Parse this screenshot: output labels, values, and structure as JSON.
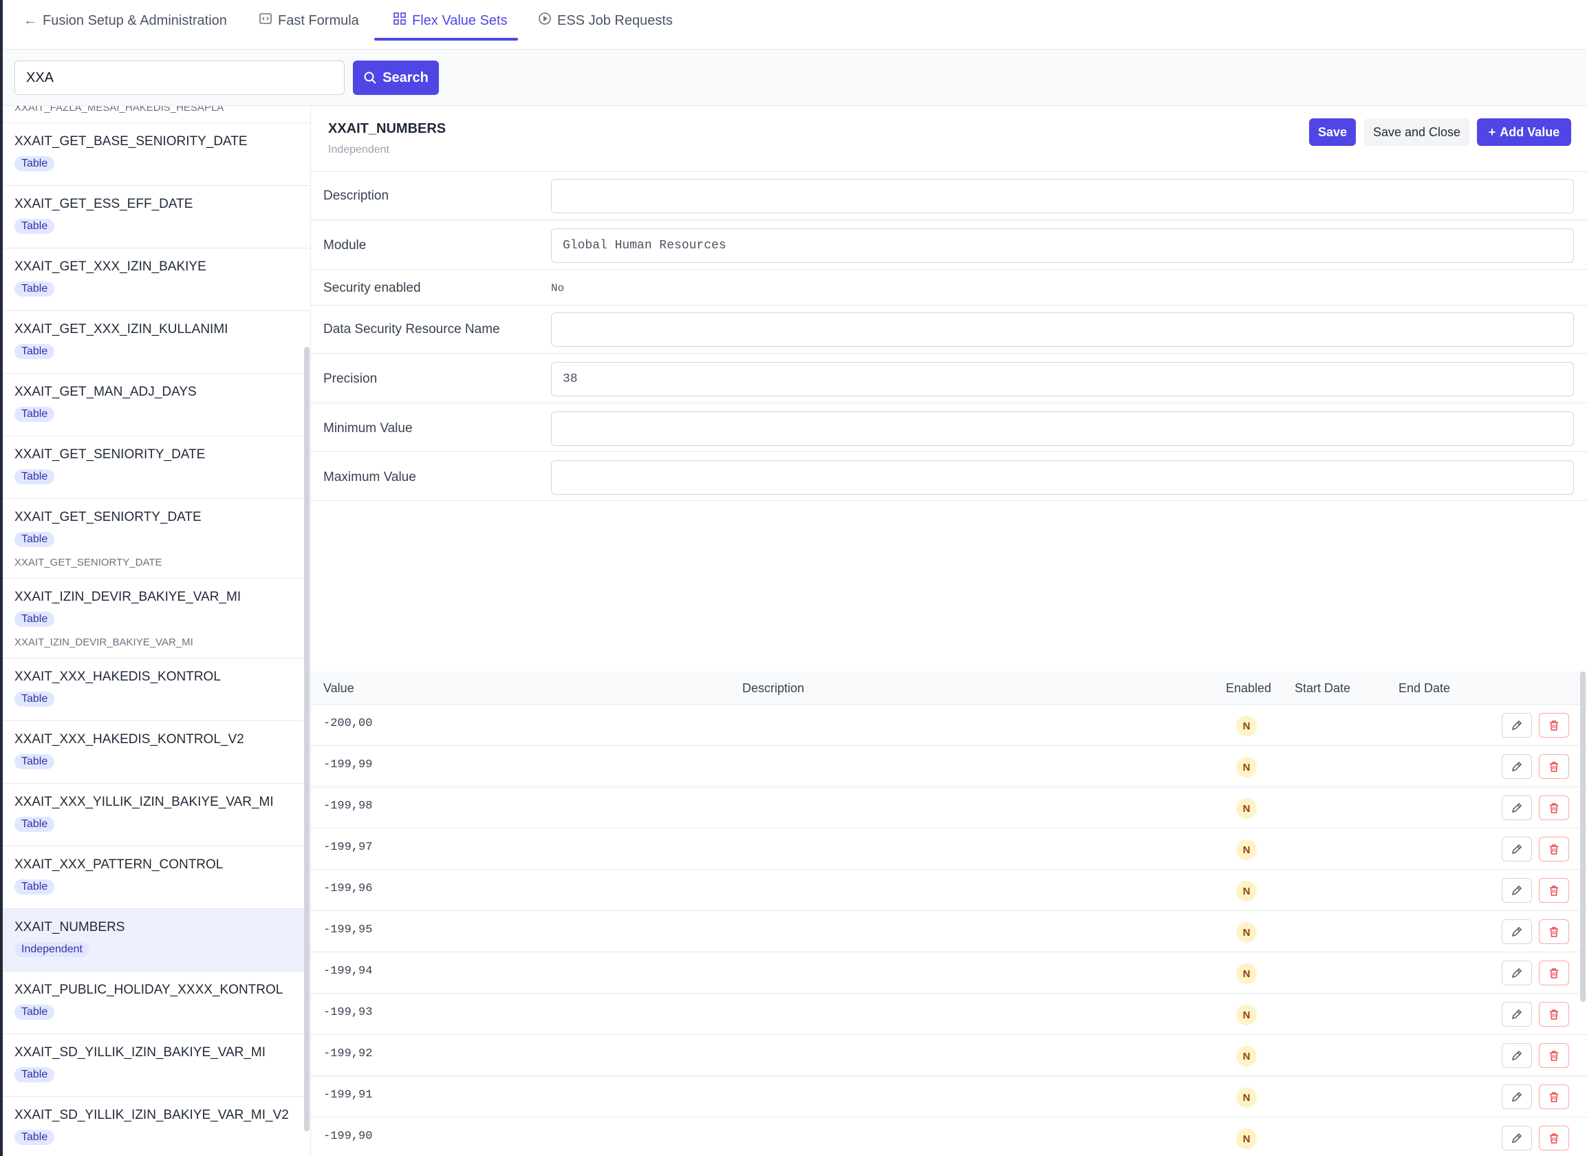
{
  "tabs": [
    {
      "label": "Fusion Setup & Administration",
      "icon": "arrow-left-icon"
    },
    {
      "label": "Fast Formula",
      "icon": "code-icon"
    },
    {
      "label": "Flex Value Sets",
      "icon": "grid-icon",
      "active": true
    },
    {
      "label": "ESS Job Requests",
      "icon": "play-circle-icon"
    }
  ],
  "search": {
    "value": "XXA",
    "button_label": "Search"
  },
  "left_list": {
    "top_cut_text": "XXAIT_FAZLA_MESAI_HAKEDIS_HESAPLA",
    "items": [
      {
        "name": "XXAIT_GET_BASE_SENIORITY_DATE",
        "badge": "Table"
      },
      {
        "name": "XXAIT_GET_ESS_EFF_DATE",
        "badge": "Table"
      },
      {
        "name": "XXAIT_GET_XXX_IZIN_BAKIYE",
        "badge": "Table"
      },
      {
        "name": "XXAIT_GET_XXX_IZIN_KULLANIMI",
        "badge": "Table"
      },
      {
        "name": "XXAIT_GET_MAN_ADJ_DAYS",
        "badge": "Table"
      },
      {
        "name": "XXAIT_GET_SENIORITY_DATE",
        "badge": "Table"
      },
      {
        "name": "XXAIT_GET_SENIORTY_DATE",
        "badge": "Table",
        "sub": "XXAIT_GET_SENIORTY_DATE"
      },
      {
        "name": "XXAIT_IZIN_DEVIR_BAKIYE_VAR_MI",
        "badge": "Table",
        "sub": "XXAIT_IZIN_DEVIR_BAKIYE_VAR_MI"
      },
      {
        "name": "XXAIT_XXX_HAKEDIS_KONTROL",
        "badge": "Table"
      },
      {
        "name": "XXAIT_XXX_HAKEDIS_KONTROL_V2",
        "badge": "Table"
      },
      {
        "name": "XXAIT_XXX_YILLIK_IZIN_BAKIYE_VAR_MI",
        "badge": "Table"
      },
      {
        "name": "XXAIT_XXX_PATTERN_CONTROL",
        "badge": "Table"
      },
      {
        "name": "XXAIT_NUMBERS",
        "badge": "Independent",
        "selected": true
      },
      {
        "name": "XXAIT_PUBLIC_HOLIDAY_XXXX_KONTROL",
        "badge": "Table"
      },
      {
        "name": "XXAIT_SD_YILLIK_IZIN_BAKIYE_VAR_MI",
        "badge": "Table"
      },
      {
        "name": "XXAIT_SD_YILLIK_IZIN_BAKIYE_VAR_MI_V2",
        "badge": "Table"
      }
    ]
  },
  "detail": {
    "title": "XXAIT_NUMBERS",
    "type": "Independent",
    "save_label": "Save",
    "save_close_label": "Save and Close",
    "add_value_label": "Add Value",
    "fields": {
      "description": {
        "label": "Description",
        "value": ""
      },
      "module": {
        "label": "Module",
        "value": "Global Human Resources"
      },
      "security": {
        "label": "Security enabled",
        "value": "No"
      },
      "data_security": {
        "label": "Data Security Resource Name",
        "value": ""
      },
      "precision": {
        "label": "Precision",
        "value": "38"
      },
      "min": {
        "label": "Minimum Value",
        "value": ""
      },
      "max": {
        "label": "Maximum Value",
        "value": ""
      }
    }
  },
  "values_table": {
    "headers": {
      "value": "Value",
      "description": "Description",
      "enabled": "Enabled",
      "start": "Start Date",
      "end": "End Date"
    },
    "rows": [
      {
        "value": "-200,00",
        "enabled": "N"
      },
      {
        "value": "-199,99",
        "enabled": "N"
      },
      {
        "value": "-199,98",
        "enabled": "N"
      },
      {
        "value": "-199,97",
        "enabled": "N"
      },
      {
        "value": "-199,96",
        "enabled": "N"
      },
      {
        "value": "-199,95",
        "enabled": "N"
      },
      {
        "value": "-199,94",
        "enabled": "N"
      },
      {
        "value": "-199,93",
        "enabled": "N"
      },
      {
        "value": "-199,92",
        "enabled": "N"
      },
      {
        "value": "-199,91",
        "enabled": "N"
      },
      {
        "value": "-199,90",
        "enabled": "N"
      }
    ]
  },
  "colors": {
    "accent": "#4f46e5",
    "badge_bg": "#e0e7ff",
    "enabled_bg": "#fef3c7",
    "delete": "#ef4444"
  }
}
